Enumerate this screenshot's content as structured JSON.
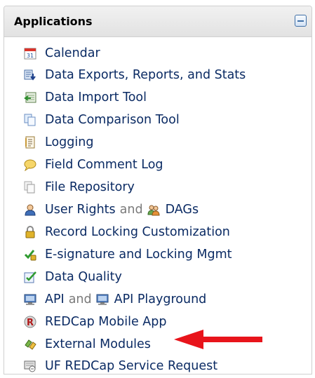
{
  "panel": {
    "title": "Applications"
  },
  "items": [
    {
      "label": "Calendar",
      "icon": "calendar-icon"
    },
    {
      "label": "Data Exports, Reports, and Stats",
      "icon": "data-export-icon"
    },
    {
      "label": "Data Import Tool",
      "icon": "data-import-icon"
    },
    {
      "label": "Data Comparison Tool",
      "icon": "data-comparison-icon"
    },
    {
      "label": "Logging",
      "icon": "logging-icon"
    },
    {
      "label": "Field Comment Log",
      "icon": "field-comment-icon"
    },
    {
      "label": "File Repository",
      "icon": "file-repository-icon"
    },
    {
      "label": "User Rights",
      "separator": "and",
      "label2": "DAGs",
      "icon": "user-rights-icon",
      "icon2": "dags-icon"
    },
    {
      "label": "Record Locking Customization",
      "icon": "record-locking-icon"
    },
    {
      "label": "E-signature and Locking Mgmt",
      "icon": "esignature-icon"
    },
    {
      "label": "Data Quality",
      "icon": "data-quality-icon"
    },
    {
      "label": "API",
      "separator": "and",
      "label2": "API Playground",
      "icon": "api-icon",
      "icon2": "api-playground-icon"
    },
    {
      "label": "REDCap Mobile App",
      "icon": "mobile-app-icon"
    },
    {
      "label": "External Modules",
      "icon": "external-modules-icon"
    },
    {
      "label": "UF REDCap Service Request",
      "icon": "service-request-icon"
    }
  ],
  "colors": {
    "link": "#0a2a63",
    "separator": "#7a7a7a",
    "annotation_arrow": "#e8141b"
  }
}
